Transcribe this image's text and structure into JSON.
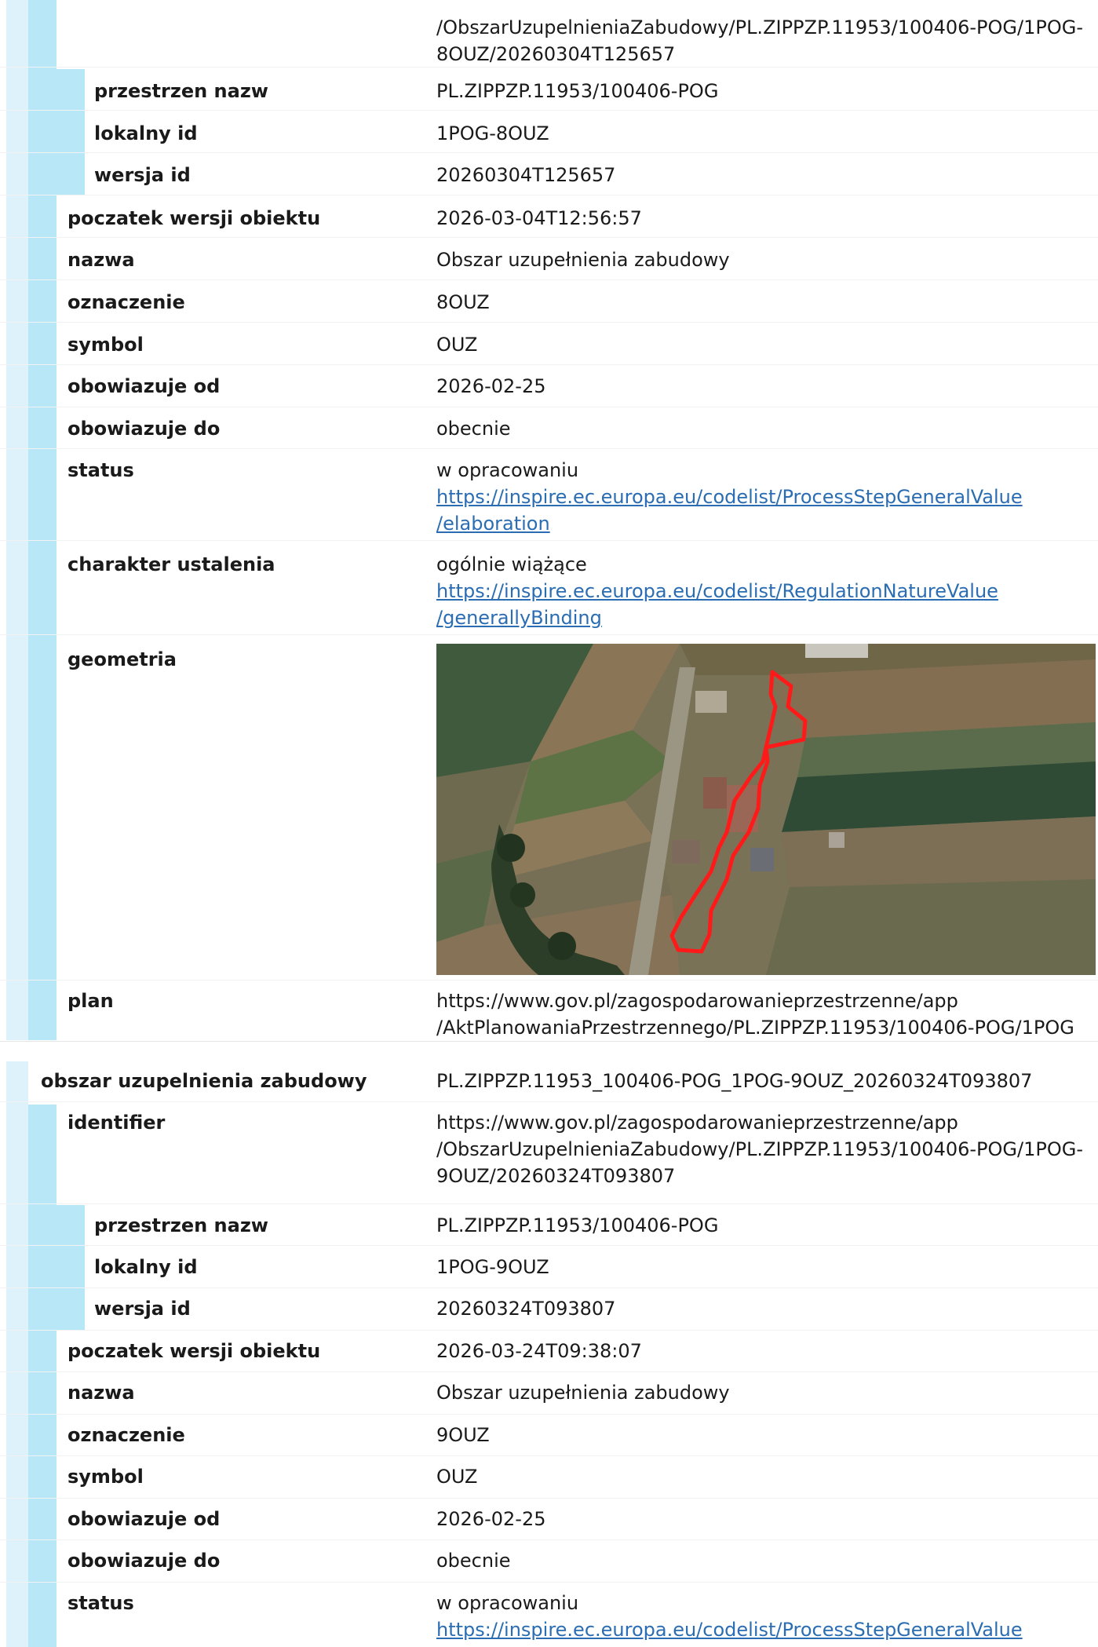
{
  "block1": {
    "identifier_tail": [
      "/ObszarUzupelnieniaZabudowy/PL.ZIPPZP.11953/100406-POG/1POG-",
      "8OUZ/20260304T125657"
    ],
    "przestrzen_nazw_label": "przestrzen nazw",
    "przestrzen_nazw": "PL.ZIPPZP.11953/100406-POG",
    "lokalny_id_label": "lokalny id",
    "lokalny_id": "1POG-8OUZ",
    "wersja_id_label": "wersja id",
    "wersja_id": "20260304T125657",
    "poczatek_label": "poczatek wersji obiektu",
    "poczatek": "2026-03-04T12:56:57",
    "nazwa_label": "nazwa",
    "nazwa": "Obszar uzupełnienia zabudowy",
    "oznaczenie_label": "oznaczenie",
    "oznaczenie": "8OUZ",
    "symbol_label": "symbol",
    "symbol": "OUZ",
    "od_label": "obowiazuje od",
    "od": "2026-02-25",
    "do_label": "obowiazuje do",
    "do": "obecnie",
    "status_label": "status",
    "status": "w opracowaniu",
    "status_link": [
      "https://inspire.ec.europa.eu/codelist/ProcessStepGeneralValue",
      "/elaboration"
    ],
    "charakter_label": "charakter ustalenia",
    "charakter": "ogólnie wiążące",
    "charakter_link": [
      "https://inspire.ec.europa.eu/codelist/RegulationNatureValue",
      "/generallyBinding"
    ],
    "geometria_label": "geometria",
    "plan_label": "plan",
    "plan": [
      "https://www.gov.pl/zagospodarowanieprzestrzenne/app",
      "/AktPlanowaniaPrzestrzennego/PL.ZIPPZP.11953/100406-POG/1POG"
    ]
  },
  "block2": {
    "title_label": "obszar uzupelnienia zabudowy",
    "title": "PL.ZIPPZP.11953_100406-POG_1POG-9OUZ_20260324T093807",
    "identifier_label": "identifier",
    "identifier": [
      "https://www.gov.pl/zagospodarowanieprzestrzenne/app",
      "/ObszarUzupelnieniaZabudowy/PL.ZIPPZP.11953/100406-POG/1POG-",
      "9OUZ/20260324T093807"
    ],
    "przestrzen_nazw_label": "przestrzen nazw",
    "przestrzen_nazw": "PL.ZIPPZP.11953/100406-POG",
    "lokalny_id_label": "lokalny id",
    "lokalny_id": "1POG-9OUZ",
    "wersja_id_label": "wersja id",
    "wersja_id": "20260324T093807",
    "poczatek_label": "poczatek wersji obiektu",
    "poczatek": "2026-03-24T09:38:07",
    "nazwa_label": "nazwa",
    "nazwa": "Obszar uzupełnienia zabudowy",
    "oznaczenie_label": "oznaczenie",
    "oznaczenie": "9OUZ",
    "symbol_label": "symbol",
    "symbol": "OUZ",
    "od_label": "obowiazuje od",
    "od": "2026-02-25",
    "do_label": "obowiazuje do",
    "do": "obecnie",
    "status_label": "status",
    "status": "w opracowaniu",
    "status_link": "https://inspire.ec.europa.eu/codelist/ProcessStepGeneralValue"
  },
  "colors": {
    "stripe_outer": "#ddf2fb",
    "stripe_inner": "#b8e8f8",
    "link": "#2a6db3",
    "outline": "#ff1a1a"
  }
}
